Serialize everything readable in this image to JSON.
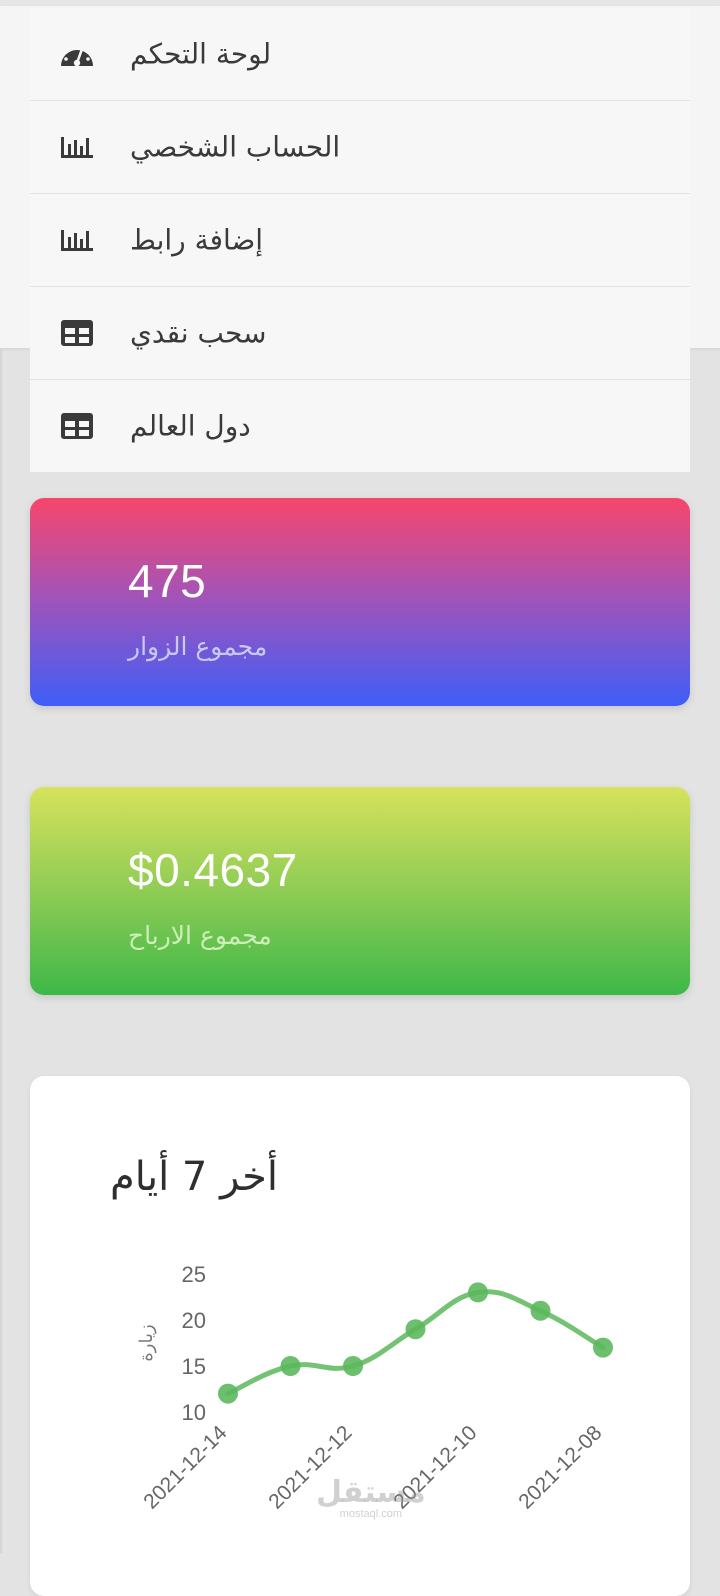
{
  "menu": {
    "items": [
      {
        "label": "لوحة التحكم",
        "icon": "dashboard-gauge-icon"
      },
      {
        "label": "الحساب الشخصي",
        "icon": "bar-chart-icon"
      },
      {
        "label": "إضافة رابط",
        "icon": "bar-chart-icon"
      },
      {
        "label": "سحب نقدي",
        "icon": "table-grid-icon"
      },
      {
        "label": "دول العالم",
        "icon": "table-grid-icon"
      }
    ]
  },
  "stats": {
    "visitors": {
      "value": "475",
      "label": "مجموع الزوار"
    },
    "earnings": {
      "value": "$0.4637",
      "label": "مجموع الارباح"
    }
  },
  "chart_section": {
    "title": "أخر 7 أيام"
  },
  "chart_data": {
    "type": "line",
    "title": "",
    "xlabel": "",
    "ylabel": "زيارة",
    "x": [
      "2021-12-14",
      "2021-12-13",
      "2021-12-12",
      "2021-12-11",
      "2021-12-10",
      "2021-12-09",
      "2021-12-08"
    ],
    "x_tick_labels": [
      "2021-12-14",
      "2021-12-12",
      "2021-12-10",
      "2021-12-08"
    ],
    "y_ticks": [
      "25",
      "20",
      "15",
      "10"
    ],
    "series": [
      {
        "values": [
          12,
          15,
          15,
          19,
          23,
          21,
          17
        ],
        "color": "#5cb85c"
      }
    ],
    "ylim": [
      10,
      25
    ],
    "grid": false,
    "legend": "none"
  },
  "watermark": {
    "main": "مستقل",
    "sub": "mostaql.com"
  },
  "colors": {
    "chart_line": "#5cb85c",
    "chart_point": "#5cb85c"
  }
}
